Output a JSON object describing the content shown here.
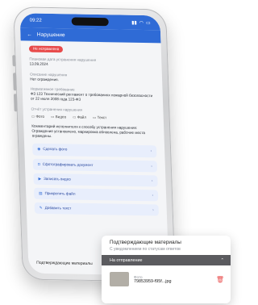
{
  "phone": {
    "status_time": "09:22",
    "title": "Нарушение",
    "status_badge": "Не исправлено",
    "fields": [
      {
        "label": "Плановая дата устранения нарушения",
        "value": "13.09.2024"
      },
      {
        "label": "Описание нарушения",
        "value": "Нет ограждения."
      },
      {
        "label": "Нормативное требование",
        "value": "Ф3 123 Технический регламент о требованиях пожарной безопасности от 22 июля 2008 года 123-ФЗ"
      }
    ],
    "attach_label": "Отчёт устранения нарушения",
    "attach_items": [
      "Фото",
      "Видео",
      "Файл",
      "Текст"
    ],
    "comment": "Комментарий исполнителя к способу устранения нарушения: Ограждение установлено, маркировка обновлена, рабочие места ограждены.",
    "actions": [
      {
        "icon": "photo-icon",
        "label": "Сделать фото"
      },
      {
        "icon": "camera-icon",
        "label": "Сфотографировать документ"
      },
      {
        "icon": "video-icon",
        "label": "Записать видео"
      },
      {
        "icon": "file-icon",
        "label": "Прикрепить файл"
      },
      {
        "icon": "text-icon",
        "label": "Добавить текст"
      }
    ],
    "bottom_label": "Подтверждающие материалы"
  },
  "card": {
    "title": "Подтверждающие материалы",
    "subtitle": "С уведомлением по статусам ответов",
    "filter_label": "На отправление",
    "file_type": "Фото",
    "file_name": "79853959-f95f...jpg"
  },
  "colors": {
    "accent": "#2f6bd6",
    "danger": "#e84b4b",
    "filter_bar": "#5b5b5f"
  }
}
